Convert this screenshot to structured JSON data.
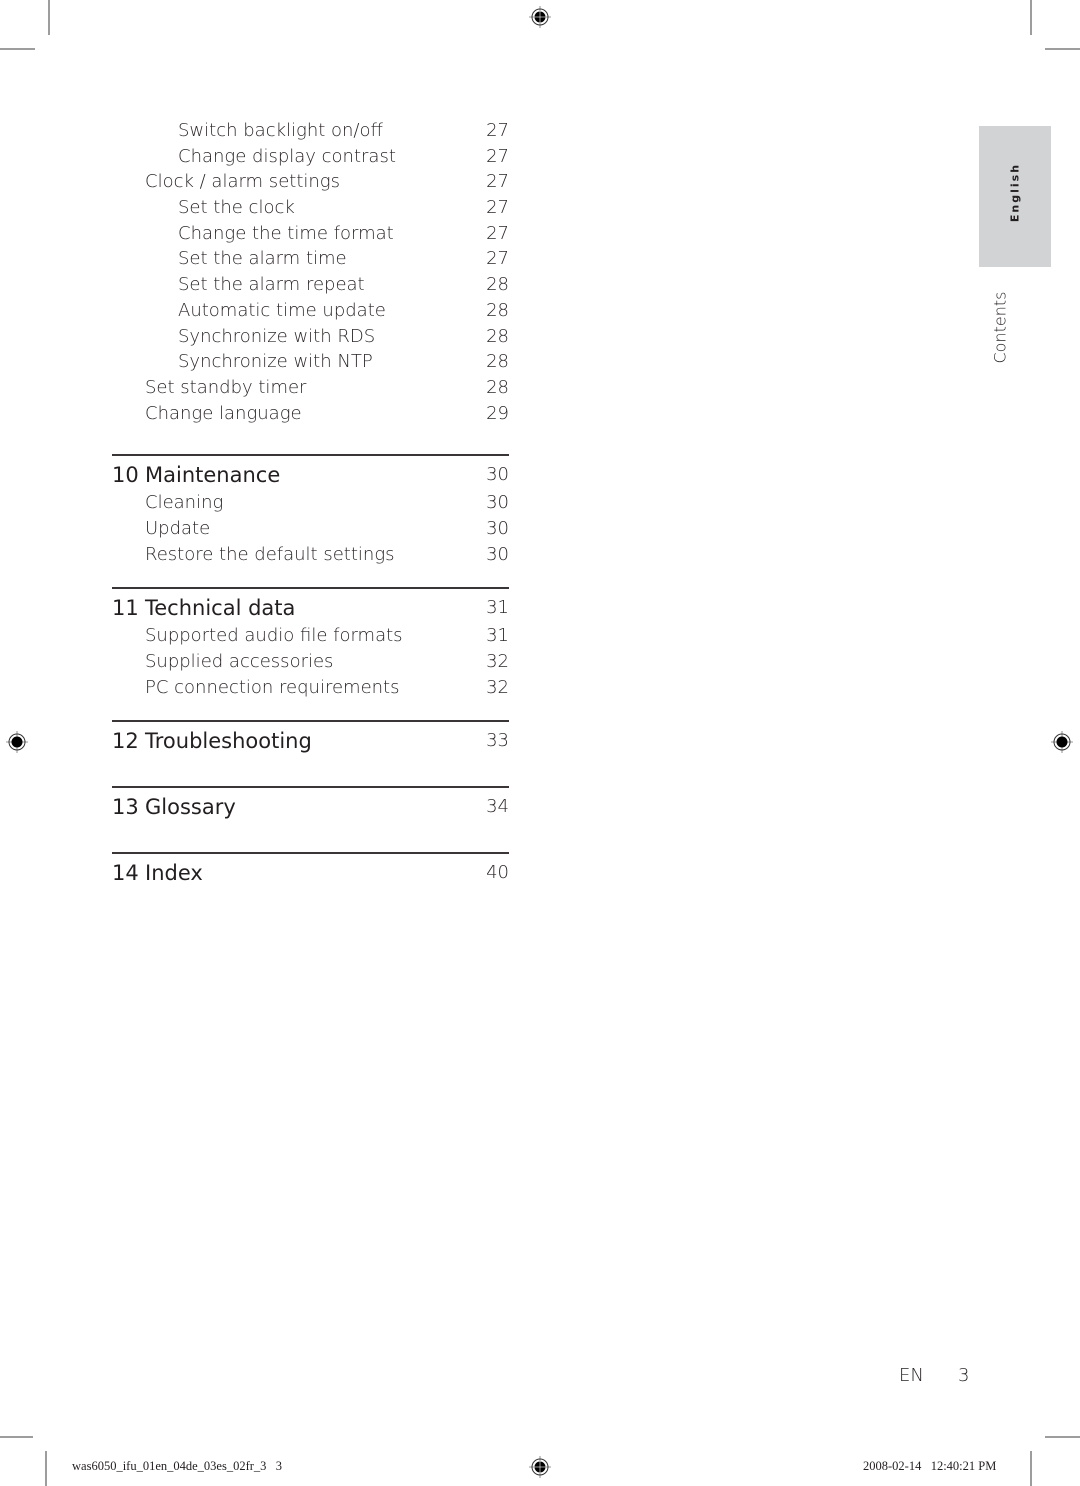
{
  "toc": {
    "continued_entries": [
      {
        "title": "Switch backlight on/off",
        "page": "27",
        "level": 2
      },
      {
        "title": "Change display contrast",
        "page": "27",
        "level": 2
      },
      {
        "title": "Clock / alarm settings",
        "page": "27",
        "level": 1
      },
      {
        "title": "Set the clock",
        "page": "27",
        "level": 2
      },
      {
        "title": "Change the time format",
        "page": "27",
        "level": 2
      },
      {
        "title": "Set the alarm time",
        "page": "27",
        "level": 2
      },
      {
        "title": "Set the alarm repeat",
        "page": "28",
        "level": 2
      },
      {
        "title": "Automatic time update",
        "page": "28",
        "level": 2
      },
      {
        "title": "Synchronize with RDS",
        "page": "28",
        "level": 2
      },
      {
        "title": "Synchronize with NTP",
        "page": "28",
        "level": 2
      },
      {
        "title": "Set standby timer",
        "page": "28",
        "level": 1
      },
      {
        "title": "Change language",
        "page": "29",
        "level": 1
      }
    ],
    "chapters": [
      {
        "number": "10",
        "title": "Maintenance",
        "page": "30",
        "entries": [
          {
            "title": "Cleaning",
            "page": "30"
          },
          {
            "title": "Update",
            "page": "30"
          },
          {
            "title": "Restore the default settings",
            "page": "30"
          }
        ]
      },
      {
        "number": "11",
        "title": "Technical data",
        "page": "31",
        "entries": [
          {
            "title": "Supported audio file formats",
            "page": "31"
          },
          {
            "title": "Supplied accessories",
            "page": "32"
          },
          {
            "title": "PC connection requirements",
            "page": "32"
          }
        ]
      },
      {
        "number": "12",
        "title": "Troubleshooting",
        "page": "33",
        "entries": []
      },
      {
        "number": "13",
        "title": "Glossary",
        "page": "34",
        "entries": []
      },
      {
        "number": "14",
        "title": "Index",
        "page": "40",
        "entries": []
      }
    ]
  },
  "side_tab": {
    "language": "English",
    "section": "Contents"
  },
  "page_footer": {
    "lang": "EN",
    "page_number": "3"
  },
  "print_slug": {
    "filename": "was6050_ifu_01en_04de_03es_02fr_3   3",
    "timestamp": "2008-02-14   12:40:21 PM"
  },
  "colors": {
    "text": "#231f20",
    "tab_bg": "#d2d3d5",
    "crop_marks": "#9d9d9d"
  }
}
